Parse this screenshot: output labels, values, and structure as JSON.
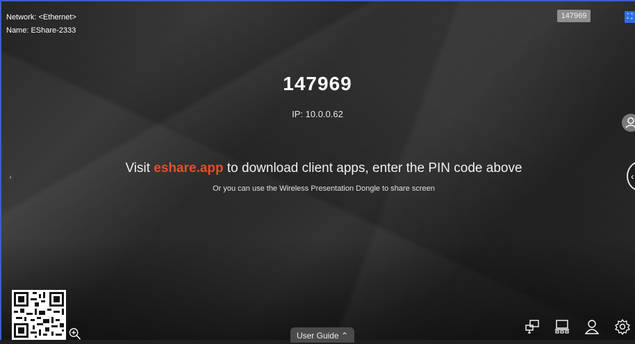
{
  "network": {
    "network_label": "Network: <Ethernet>",
    "name_label": "Name: EShare-2333"
  },
  "header": {
    "pin_badge": "147969"
  },
  "main": {
    "pin_code": "147969",
    "ip": "IP: 10.0.0.62",
    "visit_prefix": "Visit ",
    "visit_link": "eshare.app",
    "visit_suffix": " to download client apps, enter the PIN code above",
    "dongle_note": "Or you can use the Wireless Presentation Dongle to share screen"
  },
  "footer": {
    "user_guide": "User Guide"
  },
  "icons": {
    "fullscreen": "fullscreen-icon",
    "left_arrow": "chevron-right-icon",
    "user": "user-icon",
    "collapse": "chevron-left-icon",
    "qr": "qr-code",
    "zoom": "zoom-in-icon",
    "cast": "screen-cast-icon",
    "multi_screen": "multi-screen-icon",
    "user_bottom": "user-icon",
    "settings": "gear-icon"
  },
  "colors": {
    "accent": "#e2502c",
    "border": "#3a5fcd",
    "badge": "#8f8f8f"
  }
}
